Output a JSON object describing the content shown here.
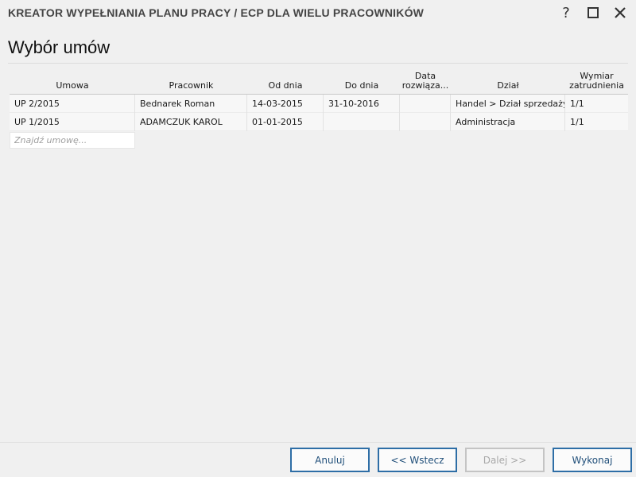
{
  "window": {
    "title": "KREATOR WYPEŁNIANIA PLANU PRACY / ECP DLA WIELU PRACOWNIKÓW",
    "help_label": "?"
  },
  "page": {
    "title": "Wybór umów"
  },
  "table": {
    "headers": {
      "umowa": "Umowa",
      "pracownik": "Pracownik",
      "od_dnia": "Od dnia",
      "do_dnia": "Do dnia",
      "data_rozwiazania_1": "Data",
      "data_rozwiazania_2": "rozwiąza...",
      "dzial": "Dział",
      "wymiar_1": "Wymiar",
      "wymiar_2": "zatrudnienia"
    },
    "rows": [
      {
        "umowa": "UP 2/2015",
        "pracownik": "Bednarek Roman",
        "od_dnia": "14-03-2015",
        "do_dnia": "31-10-2016",
        "data_rozwiazania": "",
        "dzial": "Handel > Dział sprzedaży",
        "wymiar": "1/1"
      },
      {
        "umowa": "UP 1/2015",
        "pracownik": "ADAMCZUK KAROL",
        "od_dnia": "01-01-2015",
        "do_dnia": "",
        "data_rozwiazania": "",
        "dzial": "Administracja",
        "wymiar": "1/1"
      }
    ]
  },
  "search": {
    "placeholder": "Znajdź umowę..."
  },
  "buttons": {
    "cancel": "Anuluj",
    "back": "<< Wstecz",
    "next": "Dalej >>",
    "execute": "Wykonaj"
  },
  "colors": {
    "accent": "#2e6ea6",
    "background": "#f0f0f0",
    "disabled": "#c4c4c4"
  }
}
